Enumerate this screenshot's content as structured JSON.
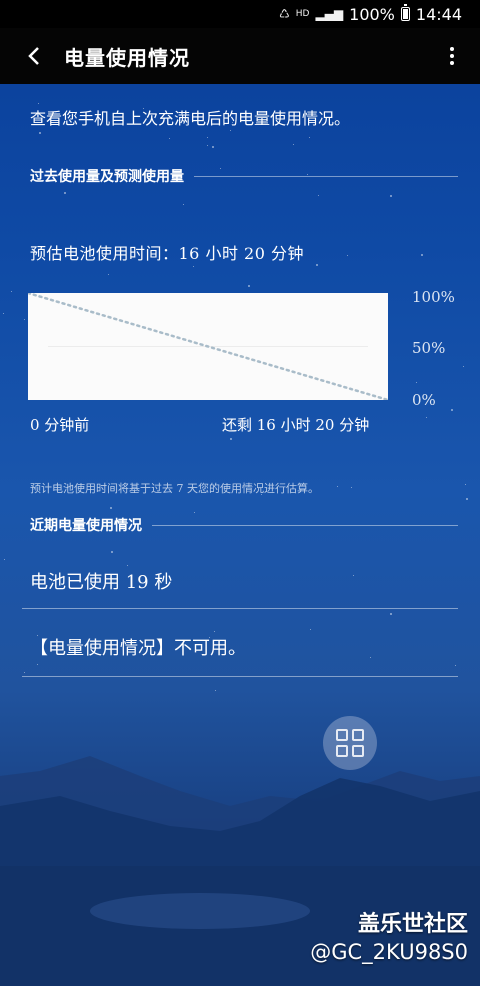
{
  "status_bar": {
    "hd_label": "HD",
    "battery_text": "100%",
    "time": "14:44"
  },
  "header": {
    "title": "电量使用情况"
  },
  "description": "查看您手机自上次充满电后的电量使用情况。",
  "section_past": {
    "title": "过去使用量及预测使用量"
  },
  "estimate_text": "预估电池使用时间：16 小时 20 分钟",
  "chart_data": {
    "type": "line",
    "x_start_label": "0 分钟前",
    "x_end_label": "还剩 16 小时 20 分钟",
    "y_tick_labels": [
      "100%",
      "50%",
      "0%"
    ],
    "ylim": [
      0,
      100
    ],
    "series": [
      {
        "style": "dotted",
        "x": [
          0,
          1
        ],
        "values": [
          100,
          0
        ]
      }
    ],
    "line_color": "#a9bcc9"
  },
  "note": "预计电池使用时间将基于过去 7 天您的使用情况进行估算。",
  "section_recent": {
    "title": "近期电量使用情况"
  },
  "battery_used": "电池已使用 19 秒",
  "unavailable": "【电量使用情况】不可用。",
  "watermark": {
    "line1": "盖乐世社区",
    "line2": "@GC_2KU98S0"
  }
}
